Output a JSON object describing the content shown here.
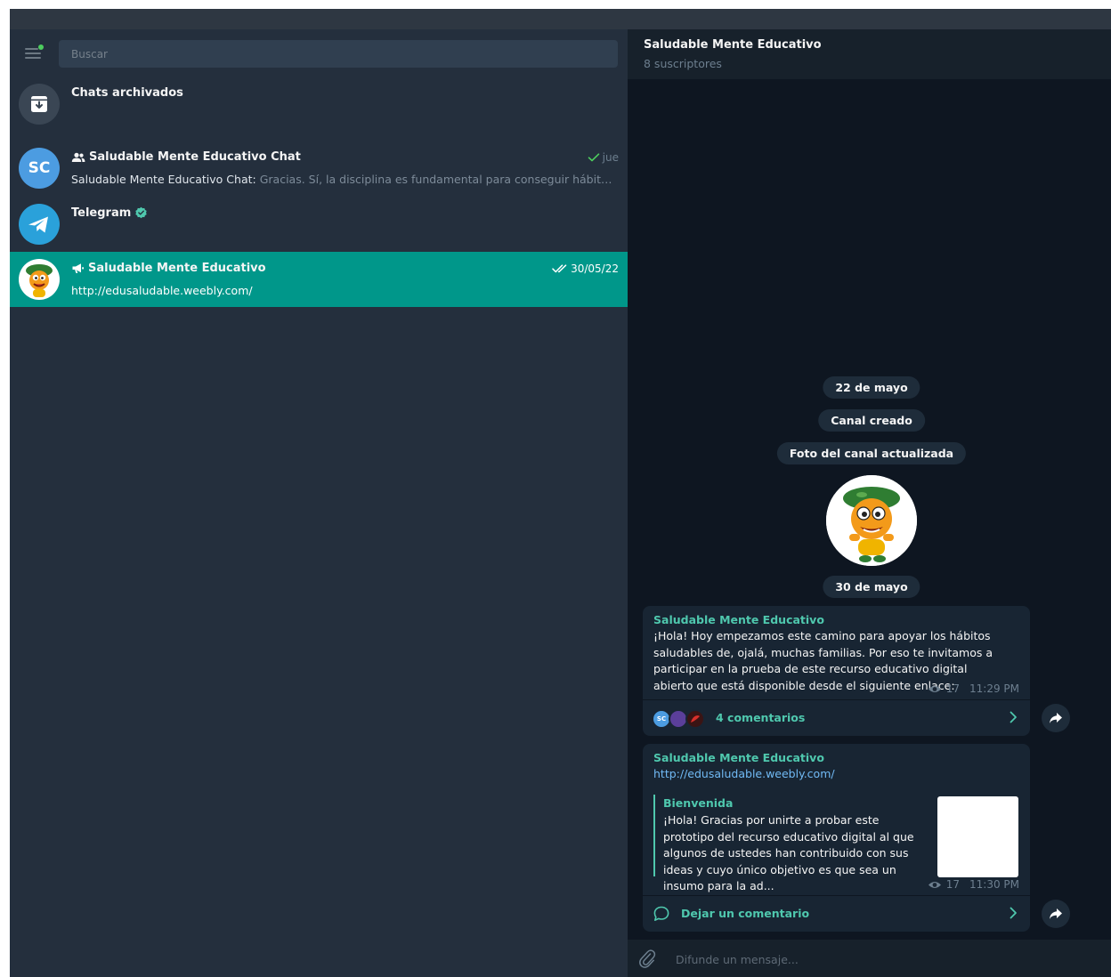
{
  "search": {
    "placeholder": "Buscar"
  },
  "chats": [
    {
      "title": "Chats archivados",
      "preview": "",
      "date": ""
    },
    {
      "title": "Saludable Mente Educativo Chat",
      "avatar_initials": "SC",
      "preview_sender": "Saludable Mente Educativo Chat:",
      "preview": "Gracias. Sí, la disciplina es fundamental para conseguir hábitos saludables...",
      "date": "jue"
    },
    {
      "title": "Telegram",
      "preview": "",
      "date": ""
    },
    {
      "title": "Saludable Mente Educativo",
      "preview": "http://edusaludable.weebly.com/",
      "date": "30/05/22"
    }
  ],
  "header": {
    "title": "Saludable Mente Educativo",
    "subtitle": "8 suscriptores"
  },
  "service": {
    "date1": "22 de mayo",
    "created": "Canal creado",
    "photo_updated": "Foto del canal actualizada",
    "date2": "30 de mayo"
  },
  "messages": [
    {
      "author": "Saludable Mente Educativo",
      "text": "¡Hola! Hoy empezamos este camino para apoyar los hábitos saludables de, ojalá, muchas familias. Por eso te invitamos a participar en la prueba de este recurso educativo digital abierto que está disponible desde el siguiente enlace:",
      "views": "17",
      "time": "11:29 PM",
      "comments_avatar": "SC",
      "comments": "4 comentarios"
    },
    {
      "author": "Saludable Mente Educativo",
      "link": "http://edusaludable.weebly.com/",
      "preview_title": "Bienvenida",
      "preview_text": "¡Hola! Gracias por unirte a probar este prototipo del recurso educativo digital al que algunos de ustedes han contribuido con sus ideas y cuyo único objetivo es que sea un insumo para la ad...",
      "views": "17",
      "time": "11:30 PM",
      "comments": "Dejar un comentario"
    }
  ],
  "composer": {
    "placeholder": "Difunde un mensaje..."
  },
  "colors": {
    "accent": "#4fc8ae",
    "active_row": "#00978a",
    "link": "#71baf5",
    "bg": "#0e1621",
    "panel": "#242f3d"
  }
}
